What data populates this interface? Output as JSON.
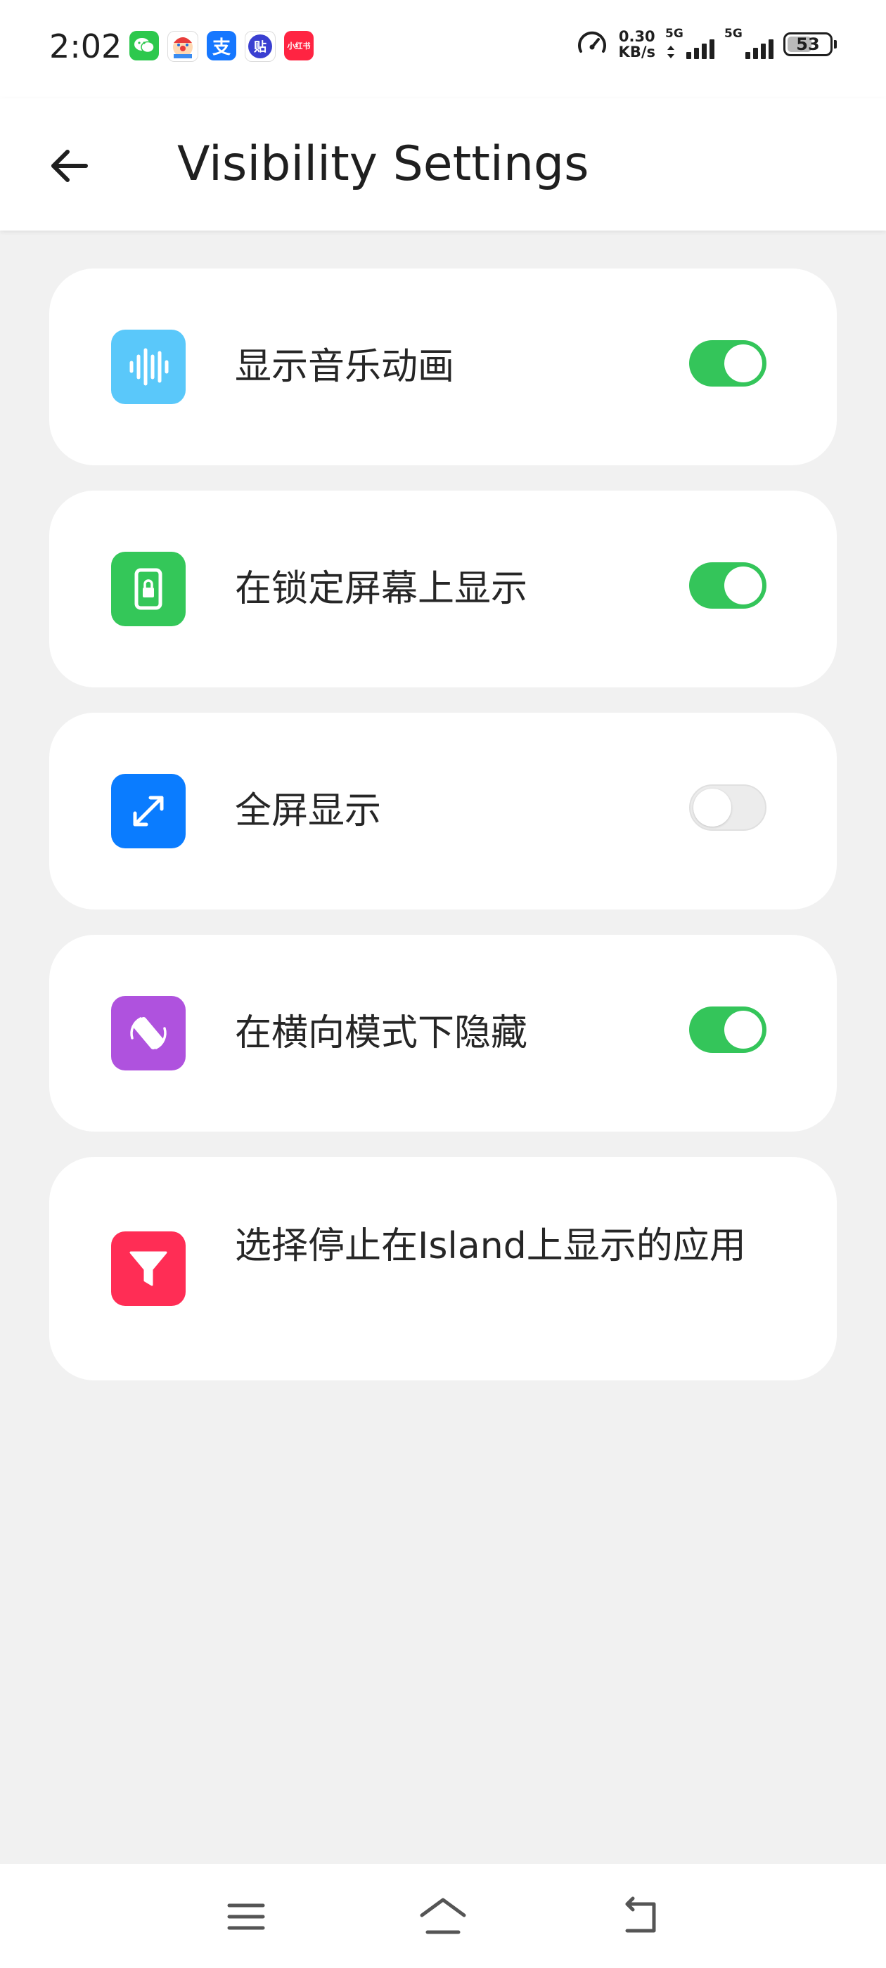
{
  "status_bar": {
    "time": "2:02",
    "apps": [
      {
        "icon": "wechat-icon",
        "color": "#2dc84d",
        "glyph": "✆"
      },
      {
        "icon": "clown-app-icon",
        "color": "#e83c3c",
        "glyph": "☺"
      },
      {
        "icon": "alipay-icon",
        "color": "#1677ff",
        "glyph": "支"
      },
      {
        "icon": "tieba-icon",
        "color": "#3a3fd1",
        "glyph": "贴"
      },
      {
        "icon": "xiaohongshu-icon",
        "color": "#ff2442",
        "glyph": "书"
      }
    ],
    "net_speed_value": "0.30",
    "net_speed_unit": "KB/s",
    "sim1_label": "5G",
    "sim2_label": "5G",
    "battery_level": "53"
  },
  "header": {
    "title": "Visibility Settings",
    "back_icon": "arrow-left-icon"
  },
  "settings": [
    {
      "label": "显示音乐动画",
      "icon": "sound-wave-icon",
      "icon_color": "#5ac8fa",
      "toggle": true
    },
    {
      "label": "在锁定屏幕上显示",
      "icon": "lock-screen-icon",
      "icon_color": "#34c759",
      "toggle": true
    },
    {
      "label": "全屏显示",
      "icon": "expand-arrows-icon",
      "icon_color": "#0a7cff",
      "toggle": false
    },
    {
      "label": "在横向模式下隐藏",
      "icon": "rotate-device-icon",
      "icon_color": "#af52de",
      "toggle": true
    },
    {
      "label": "选择停止在Island上显示的应用",
      "icon": "filter-icon",
      "icon_color": "#ff2d55",
      "toggle": null
    }
  ],
  "nav": {
    "menu_icon": "menu-icon",
    "home_icon": "home-icon",
    "back_icon": "back-return-icon"
  },
  "colors": {
    "toggle_on": "#34c55a",
    "toggle_off": "#ececec",
    "background": "#f1f1f1"
  }
}
